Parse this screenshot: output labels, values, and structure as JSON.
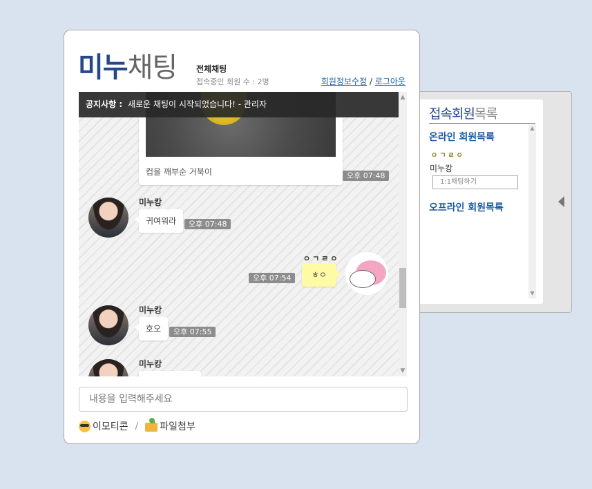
{
  "header": {
    "logo_main": "미누",
    "logo_sub": "채팅",
    "room_title": "전체채팅",
    "user_count": "접속중인 회원 수 : 2명",
    "edit_profile": "회원정보수정",
    "link_sep": "/",
    "logout": "로그아웃"
  },
  "notice": {
    "label": "공지사항 :",
    "text": "새로운 채팅이 시작되었습니다! - 관리자"
  },
  "messages": [
    {
      "type": "image",
      "caption": "컵을 깨부순 거북이",
      "time": "오후 07:48"
    },
    {
      "sender": "미누캉",
      "text": "귀여워라",
      "time": "오후 07:48"
    },
    {
      "sender": "ㅇㄱㄹㅇ",
      "text": "ㅎㅇ",
      "time": "오후 07:54",
      "mine": true
    },
    {
      "sender": "미누캉",
      "text": "호오",
      "time": "오후 07:55"
    },
    {
      "sender": "미누캉"
    }
  ],
  "input": {
    "placeholder": "내용을 입력해주세요"
  },
  "tools": {
    "emoticon": "이모티콘",
    "sep": "/",
    "attach": "파일첨부"
  },
  "side": {
    "title_main": "접속회원",
    "title_sub": "목록",
    "online_heading": "온라인 회원목록",
    "online_user": "ㅇㄱㄹㅇ",
    "member_name": "미누캉",
    "dm_button": "1:1채팅하기",
    "offline_heading": "오프라인 회원목록"
  },
  "colors": {
    "background": "#d8e3ef",
    "brand": "#26488a",
    "link": "#1b63a6",
    "my_bubble": "#fffaa4",
    "time_badge": "#8c8c8c"
  }
}
